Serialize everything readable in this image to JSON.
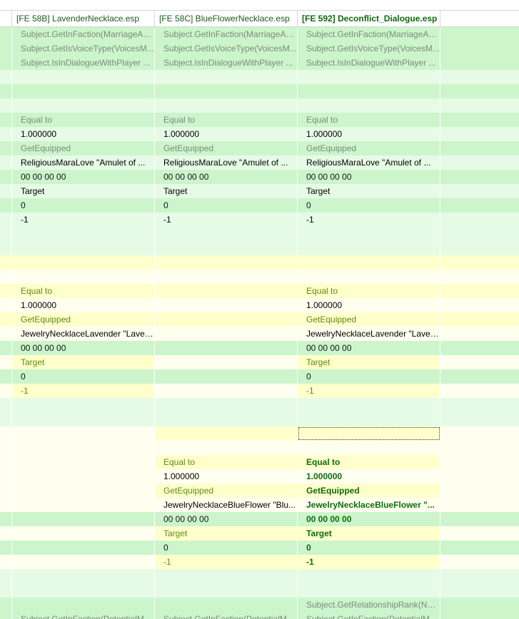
{
  "columns": [
    "",
    "[FE 58B] LavenderNecklace.esp",
    "[FE 58C] BlueFlowerNecklace.esp",
    "[FE 592] Deconflict_Dialogue.esp",
    ""
  ],
  "rows": [
    {
      "bg": [
        "g",
        "g",
        "g",
        "g",
        "g"
      ],
      "cells": [
        "",
        "Subject.GetInFaction(MarriageAs...",
        "Subject.GetInFaction(MarriageAs...",
        "Subject.GetInFaction(MarriageAs...",
        ""
      ]
    },
    {
      "bg": [
        "g",
        "g",
        "g",
        "g",
        "g"
      ],
      "cells": [
        "",
        "Subject.GetIsVoiceType(VoicesM...",
        "Subject.GetIsVoiceType(VoicesM...",
        "Subject.GetIsVoiceType(VoicesM...",
        ""
      ]
    },
    {
      "bg": [
        "g",
        "g",
        "g",
        "g",
        "g"
      ],
      "cells": [
        "",
        "Subject.IsInDialogueWithPlayer ...",
        "Subject.IsInDialogueWithPlayer ...",
        "Subject.IsInDialogueWithPlayer ...",
        ""
      ]
    },
    {
      "bg": [
        "lg",
        "lg",
        "lg",
        "lg",
        "lg"
      ],
      "cells": [
        "",
        "",
        "",
        "",
        ""
      ]
    },
    {
      "bg": [
        "g",
        "g",
        "g",
        "g",
        "g"
      ],
      "cells": [
        "",
        "",
        "",
        "",
        ""
      ]
    },
    {
      "bg": [
        "lg",
        "lg",
        "lg",
        "lg",
        "lg"
      ],
      "cells": [
        "",
        "",
        "",
        "",
        ""
      ]
    },
    {
      "bg": [
        "g",
        "g",
        "g",
        "g",
        "g"
      ],
      "cells": [
        "",
        "Equal to",
        "Equal to",
        "Equal to",
        ""
      ]
    },
    {
      "bg": [
        "lg",
        "lg",
        "lg",
        "lg",
        "lg"
      ],
      "cells": [
        "",
        "1.000000",
        "1.000000",
        "1.000000",
        ""
      ]
    },
    {
      "bg": [
        "g",
        "g",
        "g",
        "g",
        "g"
      ],
      "cells": [
        "",
        "GetEquipped",
        "GetEquipped",
        "GetEquipped",
        ""
      ]
    },
    {
      "bg": [
        "lg",
        "lg",
        "lg",
        "lg",
        "lg"
      ],
      "cells": [
        "",
        "ReligiousMaraLove \"Amulet of ...",
        "ReligiousMaraLove \"Amulet of ...",
        "ReligiousMaraLove \"Amulet of ...",
        ""
      ]
    },
    {
      "bg": [
        "gy",
        "gy",
        "gy",
        "gy",
        "gy"
      ],
      "cells": [
        "",
        "00 00 00 00",
        "00 00 00 00",
        "00 00 00 00",
        ""
      ]
    },
    {
      "bg": [
        "lg",
        "lg",
        "lg",
        "lg",
        "lg"
      ],
      "cells": [
        "",
        "Target",
        "Target",
        "Target",
        ""
      ]
    },
    {
      "bg": [
        "gy",
        "gy",
        "gy",
        "gy",
        "gy"
      ],
      "cells": [
        "",
        "0",
        "0",
        "0",
        ""
      ]
    },
    {
      "bg": [
        "lg",
        "lg",
        "lg",
        "lg",
        "lg"
      ],
      "cells": [
        "",
        "-1",
        "-1",
        "-1",
        ""
      ]
    },
    {
      "bg": [
        "lg",
        "lg",
        "lg",
        "lg",
        "lg"
      ],
      "cells": [
        "",
        "",
        "",
        "",
        ""
      ]
    },
    {
      "bg": [
        "lg",
        "lg",
        "lg",
        "lg",
        "lg"
      ],
      "cells": [
        "",
        "",
        "",
        "",
        ""
      ]
    },
    {
      "bg": [
        "y",
        "y",
        "y",
        "y",
        "y"
      ],
      "cells": [
        "",
        "",
        "",
        "",
        ""
      ]
    },
    {
      "bg": [
        "ly",
        "ly",
        "ly",
        "ly",
        "ly"
      ],
      "cells": [
        "",
        "",
        "",
        "",
        ""
      ]
    },
    {
      "bg": [
        "y",
        "y",
        "y",
        "y",
        "y"
      ],
      "cells": [
        "",
        "Equal to",
        "",
        "Equal to",
        ""
      ]
    },
    {
      "bg": [
        "ly",
        "ly",
        "ly",
        "ly",
        "ly"
      ],
      "cells": [
        "",
        "1.000000",
        "",
        "1.000000",
        ""
      ]
    },
    {
      "bg": [
        "y",
        "y",
        "y",
        "y",
        "y"
      ],
      "cells": [
        "",
        "GetEquipped",
        "",
        "GetEquipped",
        ""
      ]
    },
    {
      "bg": [
        "ly",
        "ly",
        "ly",
        "ly",
        "ly"
      ],
      "cells": [
        "",
        "JewelryNecklaceLavender \"Laven...",
        "",
        "JewelryNecklaceLavender \"Laven...",
        ""
      ]
    },
    {
      "bg": [
        "gy",
        "gy",
        "gy",
        "gy",
        "gy"
      ],
      "cells": [
        "",
        "00 00 00 00",
        "",
        "00 00 00 00",
        ""
      ]
    },
    {
      "bg": [
        "ly",
        "y",
        "ly",
        "y",
        "ly"
      ],
      "cells": [
        "",
        "Target",
        "",
        "Target",
        ""
      ]
    },
    {
      "bg": [
        "gy",
        "gy",
        "gy",
        "gy",
        "gy"
      ],
      "cells": [
        "",
        "0",
        "",
        "0",
        ""
      ]
    },
    {
      "bg": [
        "ly",
        "y",
        "ly",
        "y",
        "ly"
      ],
      "cells": [
        "",
        "-1",
        "",
        "-1",
        ""
      ]
    },
    {
      "bg": [
        "lg",
        "lg",
        "lg",
        "lg",
        "lg"
      ],
      "cells": [
        "",
        "",
        "",
        "",
        ""
      ]
    },
    {
      "bg": [
        "lg",
        "lg",
        "lg",
        "lg",
        "lg"
      ],
      "cells": [
        "",
        "",
        "",
        "",
        ""
      ]
    },
    {
      "bg": [
        "ly",
        "ly",
        "y",
        "y",
        "ly"
      ],
      "cells": [
        "",
        "",
        "",
        "",
        ""
      ]
    },
    {
      "bg": [
        "ly",
        "ly",
        "ly",
        "ly",
        "ly"
      ],
      "cells": [
        "",
        "",
        "",
        "",
        ""
      ]
    },
    {
      "bg": [
        "ly",
        "ly",
        "y",
        "y",
        "ly"
      ],
      "cells": [
        "",
        "",
        "Equal to",
        "Equal to",
        ""
      ]
    },
    {
      "bg": [
        "ly",
        "ly",
        "ly",
        "ly",
        "ly"
      ],
      "cells": [
        "",
        "",
        "1.000000",
        "1.000000",
        ""
      ]
    },
    {
      "bg": [
        "ly",
        "ly",
        "y",
        "y",
        "ly"
      ],
      "cells": [
        "",
        "",
        "GetEquipped",
        "GetEquipped",
        ""
      ]
    },
    {
      "bg": [
        "ly",
        "ly",
        "ly",
        "ly",
        "ly"
      ],
      "cells": [
        "",
        "",
        "JewelryNecklaceBlueFlower \"Blu...",
        "JewelryNecklaceBlueFlower \"...",
        ""
      ]
    },
    {
      "bg": [
        "gy",
        "gy",
        "gy",
        "gy",
        "gy"
      ],
      "cells": [
        "",
        "",
        "00 00 00 00",
        "00 00 00 00",
        ""
      ]
    },
    {
      "bg": [
        "ly",
        "ly",
        "y",
        "y",
        "ly"
      ],
      "cells": [
        "",
        "",
        "Target",
        "Target",
        ""
      ]
    },
    {
      "bg": [
        "gy",
        "gy",
        "gy",
        "gy",
        "gy"
      ],
      "cells": [
        "",
        "",
        "0",
        "0",
        ""
      ]
    },
    {
      "bg": [
        "ly",
        "ly",
        "y",
        "y",
        "ly"
      ],
      "cells": [
        "",
        "",
        "-1",
        "-1",
        ""
      ]
    },
    {
      "bg": [
        "lg",
        "lg",
        "lg",
        "lg",
        "lg"
      ],
      "cells": [
        "",
        "",
        "",
        "",
        ""
      ]
    },
    {
      "bg": [
        "lg",
        "lg",
        "lg",
        "lg",
        "lg"
      ],
      "cells": [
        "",
        "",
        "",
        "",
        ""
      ]
    },
    {
      "bg": [
        "g",
        "g",
        "g",
        "g",
        "g"
      ],
      "cells": [
        "",
        "",
        "",
        "Subject.GetRelationshipRank(NU...",
        ""
      ]
    },
    {
      "bg": [
        "g",
        "g",
        "g",
        "g",
        "g"
      ],
      "cells": [
        "",
        "Subject.GetInFaction(PotentialM...",
        "Subject.GetInFaction(PotentialM...",
        "Subject.GetInFaction(PotentialM...",
        ""
      ]
    }
  ]
}
